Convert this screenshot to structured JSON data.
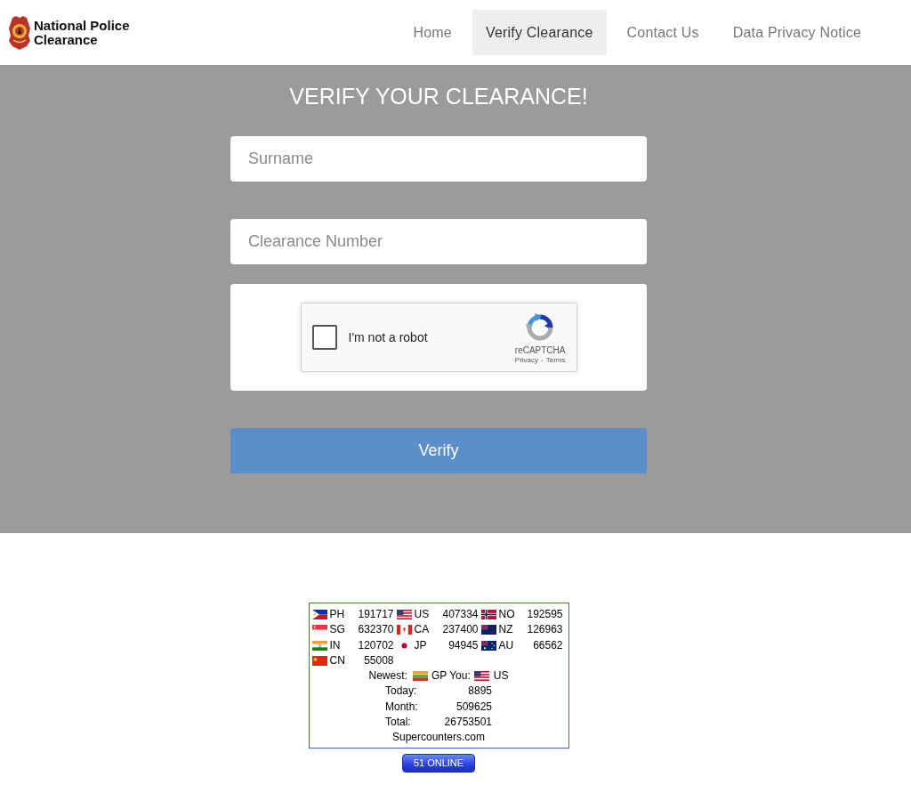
{
  "navbar": {
    "brand": "National Police Clearance",
    "items": [
      {
        "label": "Home",
        "selected": false
      },
      {
        "label": "Verify Clearance",
        "selected": true
      },
      {
        "label": "Contact Us",
        "selected": false
      },
      {
        "label": "Data Privacy Notice",
        "selected": false
      }
    ]
  },
  "form": {
    "title": "VERIFY YOUR CLEARANCE!",
    "fields": [
      {
        "placeholder": "Surname"
      },
      {
        "placeholder": "Clearance Number"
      }
    ],
    "captcha": {
      "label": "I'm not a robot",
      "checked": false,
      "brand": "reCAPTCHA",
      "privacy": "Privacy",
      "separator": "-",
      "terms": "Terms"
    },
    "submit": "Verify"
  },
  "counter": {
    "countries": [
      {
        "kind": "ph",
        "code": "PH",
        "count": "191717"
      },
      {
        "kind": "us",
        "code": "US",
        "count": "407334"
      },
      {
        "kind": "no",
        "code": "NO",
        "count": "192595"
      },
      {
        "kind": "sg",
        "code": "SG",
        "count": "632370"
      },
      {
        "kind": "ca",
        "code": "CA",
        "count": "237400"
      },
      {
        "kind": "nz",
        "code": "NZ",
        "count": "126963"
      },
      {
        "kind": "in",
        "code": "IN",
        "count": "120702"
      },
      {
        "kind": "jp",
        "code": "JP",
        "count": "94945"
      },
      {
        "kind": "au",
        "code": "AU",
        "count": "66562"
      },
      {
        "kind": "cn",
        "code": "CN",
        "count": "55008"
      }
    ],
    "newest": {
      "label": "Newest:",
      "kind": "gp",
      "code": "GP"
    },
    "you": {
      "label": "You:",
      "kind": "us",
      "code": "US"
    },
    "stats": [
      {
        "label": "Today:",
        "value": "8895"
      },
      {
        "label": "Month:",
        "value": "509625"
      },
      {
        "label": "Total:",
        "value": "26753501"
      }
    ],
    "footer": "Supercounters.com",
    "online": "51 ONLINE"
  }
}
